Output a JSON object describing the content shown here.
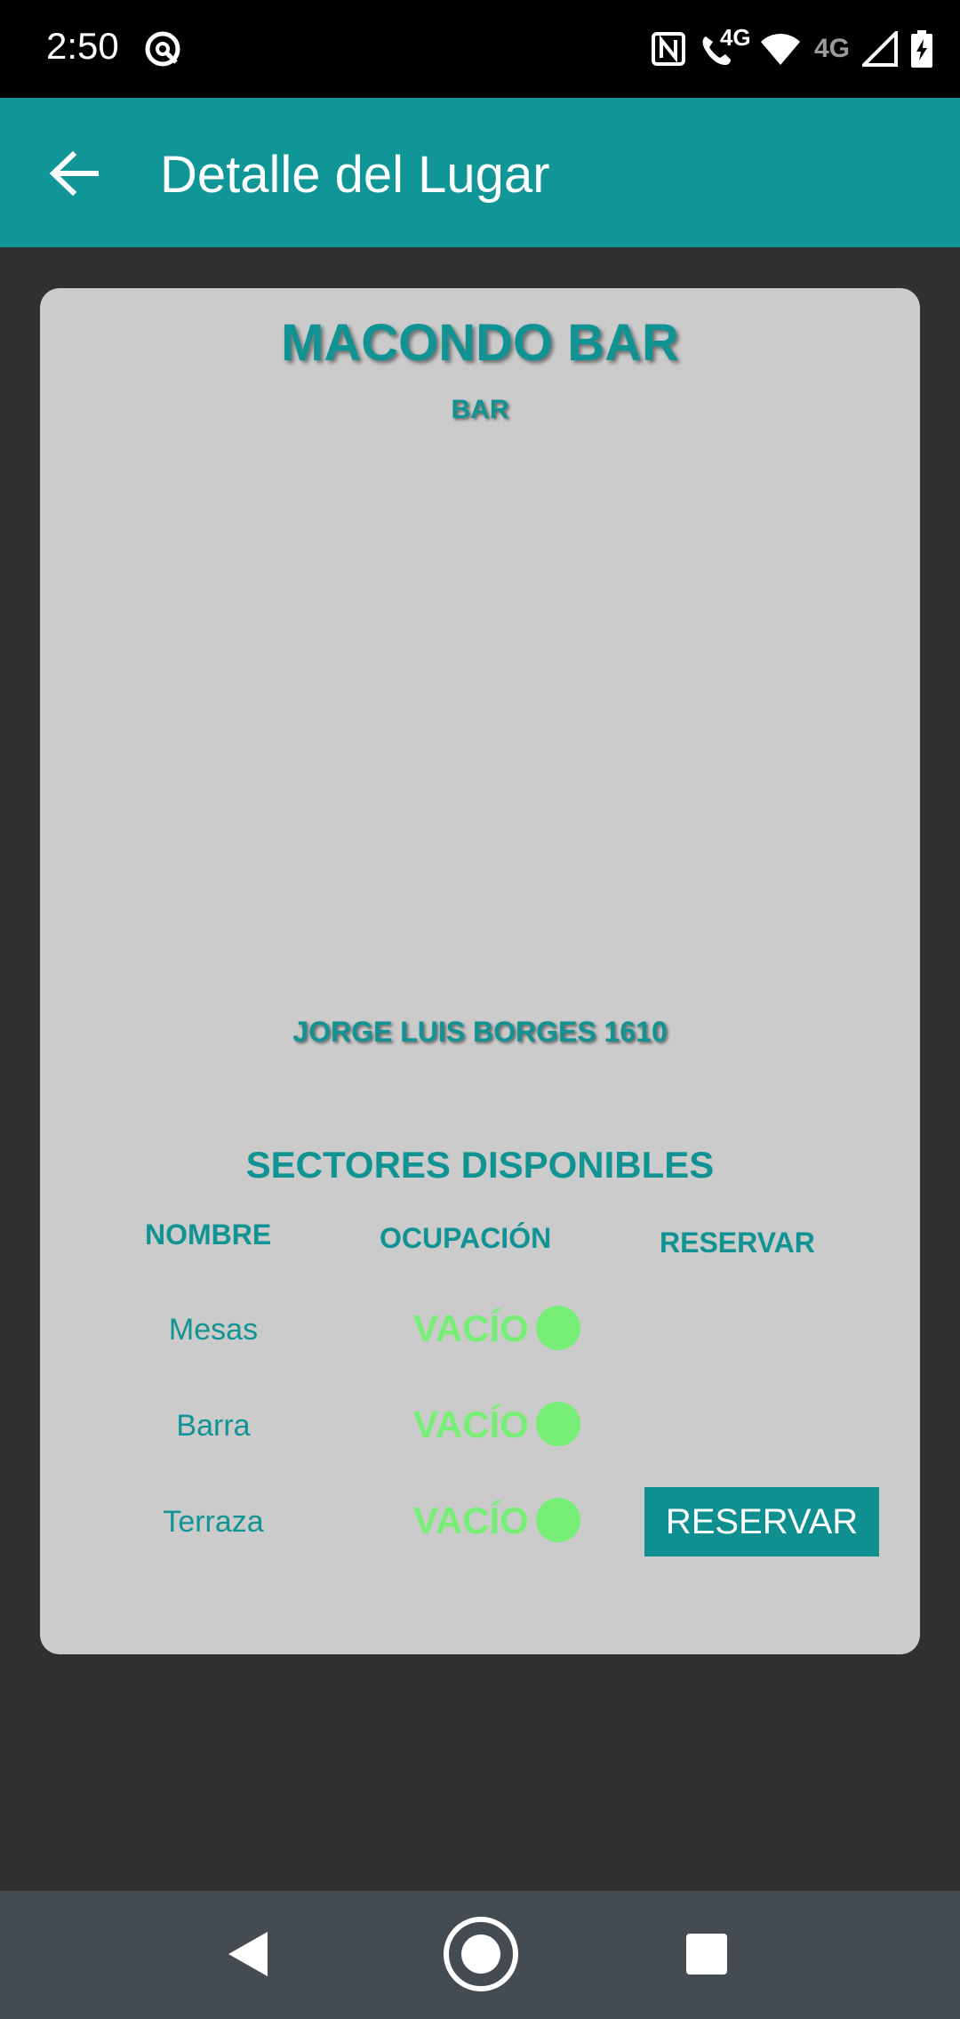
{
  "status_bar": {
    "time": "2:50",
    "network_label_1": "4G",
    "network_label_2": "4G",
    "icons": [
      "vpn-key-icon",
      "nfc-icon",
      "wifi-call-icon",
      "wifi-icon",
      "signal-icon",
      "battery-charging-icon"
    ]
  },
  "app_bar": {
    "title": "Detalle del Lugar",
    "back_icon": "arrow-back-icon"
  },
  "place": {
    "name": "MACONDO BAR",
    "type": "BAR",
    "address": "JORGE LUIS BORGES 1610"
  },
  "sectors": {
    "title": "SECTORES DISPONIBLES",
    "columns": {
      "name": "NOMBRE",
      "occupancy": "OCUPACIÓN",
      "reserve": "RESERVAR"
    },
    "rows": [
      {
        "name": "Mesas",
        "status": "VACÍO"
      },
      {
        "name": "Barra",
        "status": "VACÍO"
      },
      {
        "name": "Terraza",
        "status": "VACÍO"
      }
    ],
    "reserve_button_label": "RESERVAR"
  },
  "colors": {
    "app_bar": "#109696",
    "accent_text": "#129393",
    "status_green": "#77ef77",
    "card_bg": "#cbcbcb",
    "page_bg": "#303030"
  },
  "nav_bar": {
    "icons": [
      "nav-back-icon",
      "nav-home-icon",
      "nav-recent-icon"
    ]
  }
}
